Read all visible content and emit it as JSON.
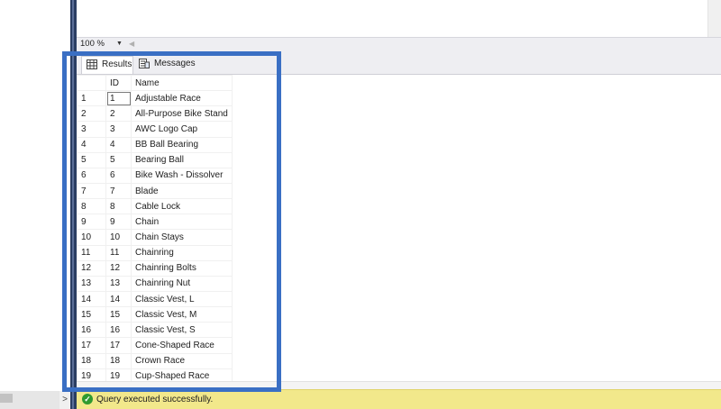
{
  "zoom": {
    "value": "100 %"
  },
  "tabs": [
    {
      "label": "Results"
    },
    {
      "label": "Messages"
    }
  ],
  "grid": {
    "columns": [
      "ID",
      "Name"
    ],
    "rows": [
      {
        "num": "1",
        "id": "1",
        "name": "Adjustable Race"
      },
      {
        "num": "2",
        "id": "2",
        "name": "All-Purpose Bike Stand"
      },
      {
        "num": "3",
        "id": "3",
        "name": "AWC Logo Cap"
      },
      {
        "num": "4",
        "id": "4",
        "name": "BB Ball Bearing"
      },
      {
        "num": "5",
        "id": "5",
        "name": "Bearing Ball"
      },
      {
        "num": "6",
        "id": "6",
        "name": "Bike Wash - Dissolver"
      },
      {
        "num": "7",
        "id": "7",
        "name": "Blade"
      },
      {
        "num": "8",
        "id": "8",
        "name": "Cable Lock"
      },
      {
        "num": "9",
        "id": "9",
        "name": "Chain"
      },
      {
        "num": "10",
        "id": "10",
        "name": "Chain Stays"
      },
      {
        "num": "11",
        "id": "11",
        "name": "Chainring"
      },
      {
        "num": "12",
        "id": "12",
        "name": "Chainring Bolts"
      },
      {
        "num": "13",
        "id": "13",
        "name": "Chainring Nut"
      },
      {
        "num": "14",
        "id": "14",
        "name": "Classic Vest, L"
      },
      {
        "num": "15",
        "id": "15",
        "name": "Classic Vest, M"
      },
      {
        "num": "16",
        "id": "16",
        "name": "Classic Vest, S"
      },
      {
        "num": "17",
        "id": "17",
        "name": "Cone-Shaped Race"
      },
      {
        "num": "18",
        "id": "18",
        "name": "Crown Race"
      },
      {
        "num": "19",
        "id": "19",
        "name": "Cup-Shaped Race"
      }
    ]
  },
  "status": {
    "message": "Query executed successfully."
  },
  "colors": {
    "highlight": "#3a6fc4",
    "status_bar": "#f2e88b",
    "splitter": "#2b3e63"
  }
}
